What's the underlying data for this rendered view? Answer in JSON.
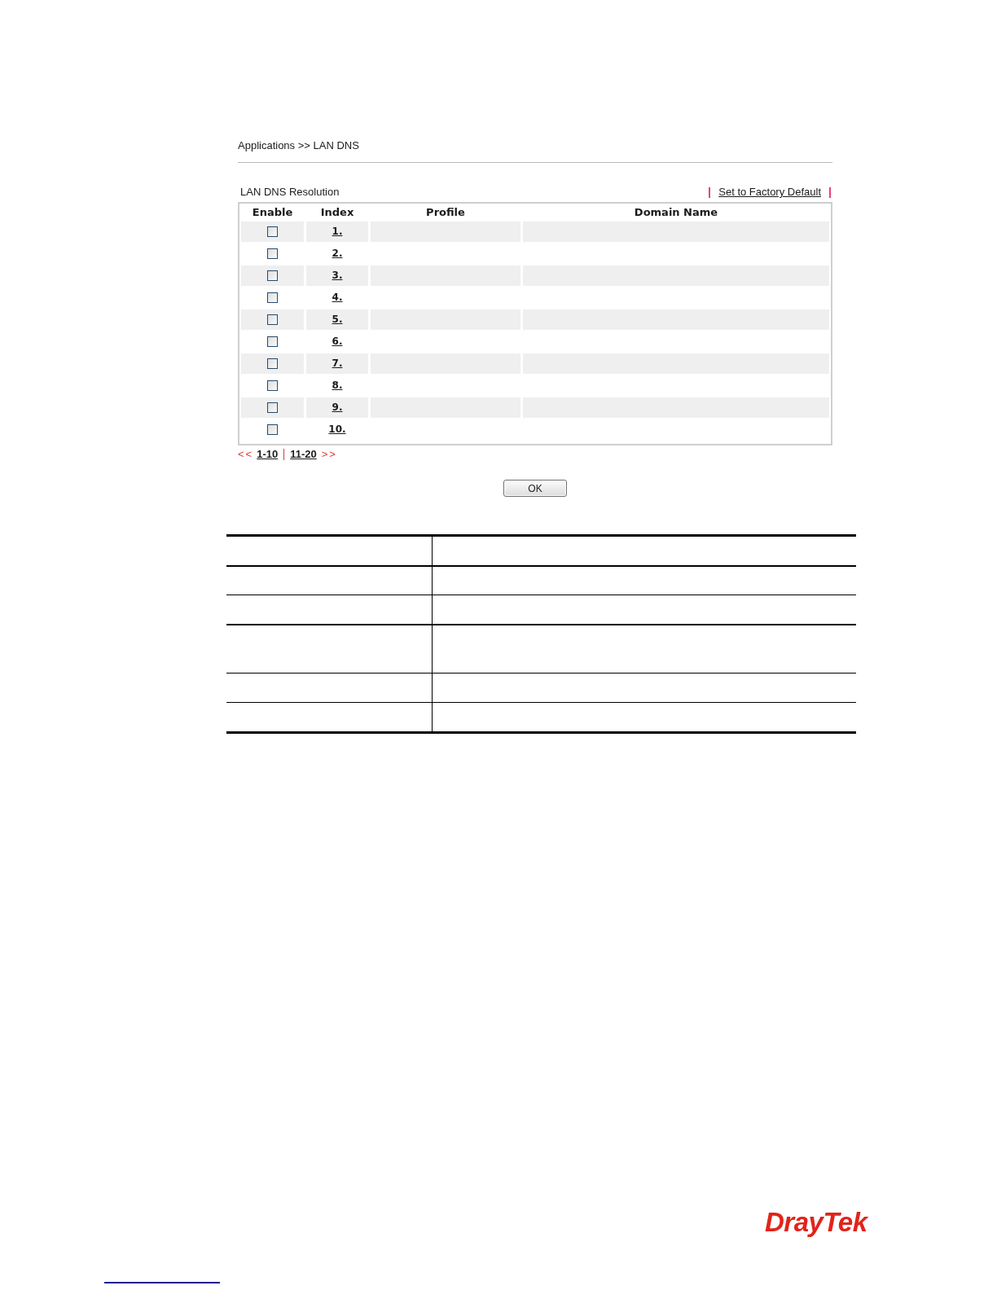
{
  "breadcrumb": "Applications >> LAN DNS",
  "section": {
    "title": "LAN DNS Resolution",
    "factory_default_link": "Set to Factory Default"
  },
  "table": {
    "columns": [
      "Enable",
      "Index",
      "Profile",
      "Domain Name"
    ],
    "rows": [
      {
        "enabled": false,
        "index": "1."
      },
      {
        "enabled": false,
        "index": "2."
      },
      {
        "enabled": false,
        "index": "3."
      },
      {
        "enabled": false,
        "index": "4."
      },
      {
        "enabled": false,
        "index": "5."
      },
      {
        "enabled": false,
        "index": "6."
      },
      {
        "enabled": false,
        "index": "7."
      },
      {
        "enabled": false,
        "index": "8."
      },
      {
        "enabled": false,
        "index": "9."
      },
      {
        "enabled": false,
        "index": "10."
      }
    ]
  },
  "pagination": {
    "prev": "<<",
    "pages": [
      "1-10",
      "11-20"
    ],
    "next": ">>"
  },
  "buttons": [
    {
      "label": "OK"
    }
  ],
  "logo": "DrayTek"
}
